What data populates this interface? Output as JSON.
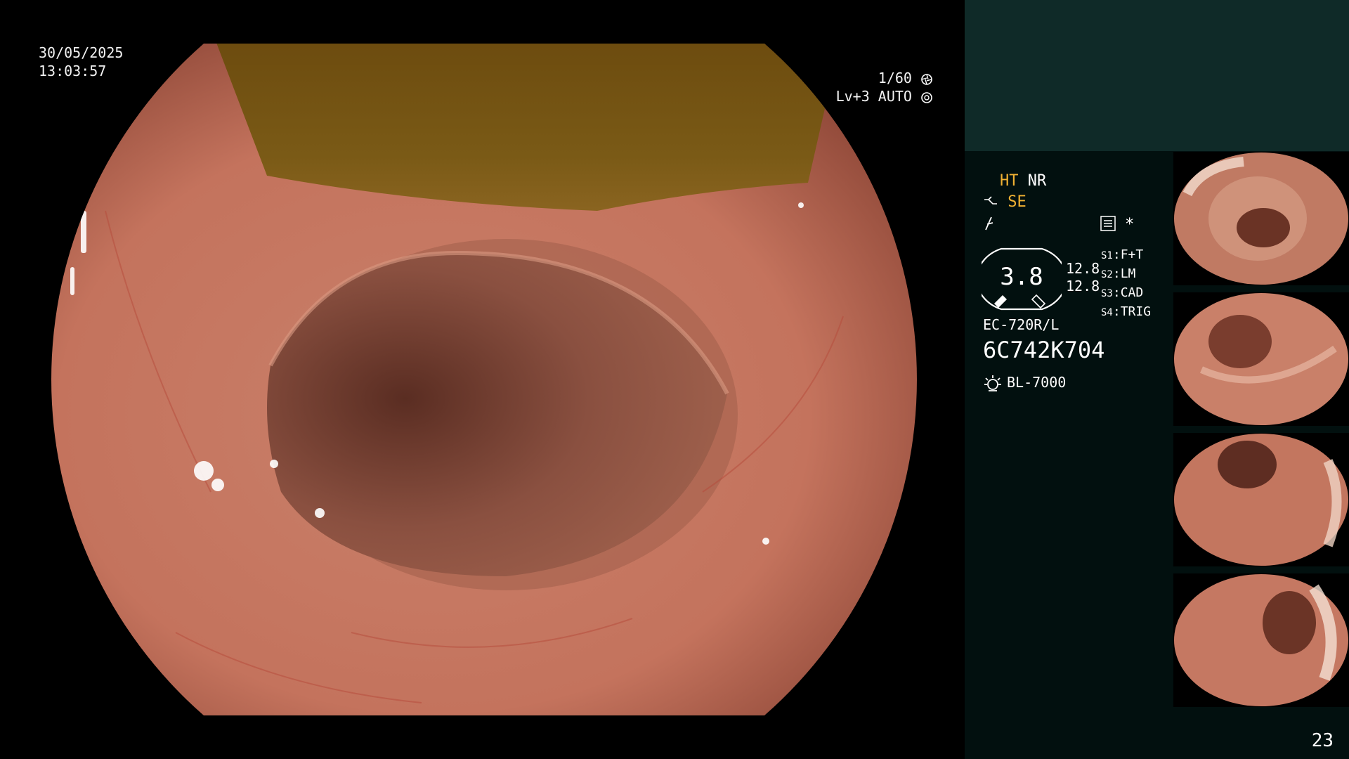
{
  "overlay": {
    "date": "30/05/2025",
    "time": "13:03:57",
    "shutter": "1/60",
    "level": "Lv+3 AUTO"
  },
  "panel": {
    "ht_label": "HT",
    "nr_label": "NR",
    "se_label": "SE",
    "star": "*",
    "gauge_value": "3.8",
    "side_values": [
      "12.8",
      "12.8"
    ],
    "settings": [
      {
        "key": "S1",
        "value": "F+T"
      },
      {
        "key": "S2",
        "value": "LM"
      },
      {
        "key": "S3",
        "value": "CAD"
      },
      {
        "key": "S4",
        "value": "TRIG"
      }
    ],
    "scope_model": "EC-720R/L",
    "scope_serial": "6C742K704",
    "light_source": "BL-7000"
  },
  "page_number": "23",
  "colors": {
    "mode_yellow": "#f2b233",
    "panel_top": "#0f2a28",
    "panel_body": "#02100f"
  },
  "icons": [
    "shutter-icon",
    "auto-icon",
    "structure-icon",
    "flag-icon",
    "menu-icon",
    "light-source-icon"
  ]
}
